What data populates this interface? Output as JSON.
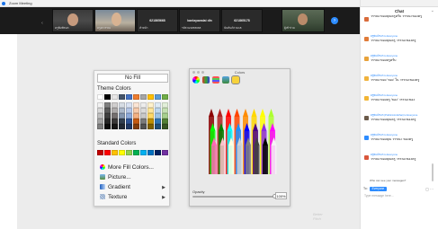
{
  "window": {
    "title": "Zoom Meeting"
  },
  "participants": [
    {
      "name": "ครูพิมพ์ชนก",
      "type": "video"
    },
    {
      "name": "ครูอรวรรณ",
      "type": "video"
    },
    {
      "name": "หัวหน้า",
      "type": "name-only",
      "center_label": "621865668"
    },
    {
      "name": "รหัส 621865668",
      "type": "name-only",
      "center_label": "kanlayawalai dln"
    },
    {
      "name": "นันท์นภัส 6218",
      "type": "name-only",
      "center_label": "621865178"
    },
    {
      "name": "ผู้เข้าร่วม",
      "type": "video"
    }
  ],
  "fill_menu": {
    "no_fill": "No Fill",
    "theme_colors_label": "Theme Colors",
    "standard_colors_label": "Standard Colors",
    "theme_top_row": [
      "#ffffff",
      "#000000",
      "#e7e6e6",
      "#44546a",
      "#4472c4",
      "#ed7d31",
      "#a5a5a5",
      "#ffc000",
      "#5b9bd5",
      "#70ad47"
    ],
    "theme_shades": [
      [
        "#f2f2f2",
        "#7f7f7f",
        "#d0cece",
        "#d6dce4",
        "#d9e2f3",
        "#fbe5d5",
        "#ededed",
        "#fff2cc",
        "#deebf6",
        "#e2efd9"
      ],
      [
        "#d8d8d8",
        "#595959",
        "#aeabab",
        "#adb9ca",
        "#b4c6e7",
        "#f7cbac",
        "#dbdbdb",
        "#fee599",
        "#bdd7ee",
        "#c5e0b3"
      ],
      [
        "#bfbfbf",
        "#3f3f3f",
        "#757070",
        "#8496b0",
        "#8eaadb",
        "#f4b183",
        "#c9c9c9",
        "#ffd965",
        "#9cc3e5",
        "#a8d08d"
      ],
      [
        "#a5a5a5",
        "#262626",
        "#3a3838",
        "#323f4f",
        "#2f5496",
        "#c55a11",
        "#7b7b7b",
        "#bf9000",
        "#2e75b5",
        "#538135"
      ],
      [
        "#7f7f7f",
        "#0c0c0c",
        "#171616",
        "#222a35",
        "#1f3864",
        "#833c0b",
        "#525252",
        "#7f6000",
        "#1e4e79",
        "#375623"
      ]
    ],
    "standard_colors": [
      "#c00000",
      "#ff0000",
      "#ffc000",
      "#ffff00",
      "#92d050",
      "#00b050",
      "#00b0f0",
      "#0070c0",
      "#002060",
      "#7030a0"
    ],
    "items": [
      {
        "label": "More Fill Colors...",
        "icon": "color-wheel-icon",
        "has_submenu": false
      },
      {
        "label": "Picture...",
        "icon": "picture-icon",
        "has_submenu": false
      },
      {
        "label": "Gradient",
        "icon": "gradient-icon",
        "has_submenu": true
      },
      {
        "label": "Texture",
        "icon": "texture-icon",
        "has_submenu": true
      }
    ]
  },
  "colors_dialog": {
    "title": "Colors",
    "tabs": [
      "color-wheel",
      "color-sliders",
      "color-palettes",
      "image-palettes",
      "crayons"
    ],
    "selected_tab": "crayons",
    "opacity_label": "Opacity",
    "opacity_value": "100%",
    "opacity_fraction": 1.0,
    "crayons": [
      "#8b0000",
      "#b22222",
      "#ff0000",
      "#ff4500",
      "#ff8c00",
      "#ffd700",
      "#ffff00",
      "#adff2f",
      "#00ff00",
      "#008000",
      "#00ffff",
      "#1e90ff",
      "#0000ff",
      "#4b0082",
      "#8a2be2",
      "#ff00ff",
      "#ff69b4",
      "#ffc0cb",
      "#ffffe0",
      "#d3d3d3",
      "#808080",
      "#404040",
      "#000000",
      "#f5f5f5"
    ]
  },
  "watermark": {
    "line1": "Better",
    "line2": "Pitch"
  },
  "chat": {
    "title": "Chat",
    "messages": [
      {
        "from": "",
        "text": "วรรณะของคุณครูครับ วรรณะของครู",
        "avatar_color": "#d96b3b"
      },
      {
        "from": "ครูพิมพ์ชนก to Everyone",
        "text": "วรรณะของคุณครู วรรณะของครู",
        "avatar_color": "#e07b39"
      },
      {
        "from": "ครูพิมพ์ชนก to Everyone",
        "text": "วรรณะของครูครับ",
        "avatar_color": "#e8a23a"
      },
      {
        "from": "ครูพิมพ์ชนก to Everyone",
        "text": "วรรณะของ 'ของ' ใน วรรณะของครู",
        "avatar_color": "#f0b23c"
      },
      {
        "from": "ครูพิมพ์ชนก to Everyone",
        "text": "วรรณะของครู 'ของ' วรรณะของ",
        "avatar_color": "#f2b535"
      },
      {
        "from": "ครูพิมพ์ชนก (Publicmindsthai) to Everyone",
        "text": "วรรณะของคุณครู วรรณะของครู",
        "avatar_color": "#6b5a4a"
      },
      {
        "from": "ครูพิมพ์ชนก to Everyone",
        "text": "วรรณะของคุณ วรรณะ ของครู",
        "avatar_color": "#2d8cff"
      },
      {
        "from": "ครูพิมพ์ชนก to Everyone",
        "text": "วรรณะของคุณครู วรรณะของครู",
        "avatar_color": "#d9563b"
      }
    ],
    "hint": "Who can see your messages?",
    "to_label": "To:",
    "to_value": "Everyone",
    "placeholder": "Type message here..."
  }
}
